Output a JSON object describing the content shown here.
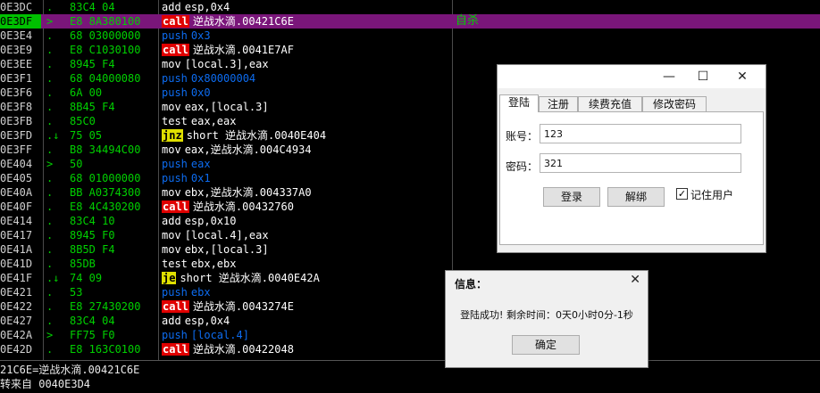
{
  "disasm": {
    "rows": [
      {
        "addr": "0E3DC",
        "mark": ".",
        "hex": "83C4 04",
        "mnem": "add",
        "ops": "esp,0x4",
        "kind": "plain",
        "sel": false
      },
      {
        "addr": "0E3DF",
        "mark": ">",
        "hex": "E8 8A380100",
        "mnem": "call",
        "ops": "逆战水滴.00421C6E",
        "kind": "call",
        "sel": true,
        "comment": "自杀"
      },
      {
        "addr": "0E3E4",
        "mark": ".",
        "hex": "68 03000000",
        "mnem": "push",
        "ops": "0x3",
        "kind": "push",
        "sel": false
      },
      {
        "addr": "0E3E9",
        "mark": ".",
        "hex": "E8 C1030100",
        "mnem": "call",
        "ops": "逆战水滴.0041E7AF",
        "kind": "call",
        "sel": false
      },
      {
        "addr": "0E3EE",
        "mark": ".",
        "hex": "8945 F4",
        "mnem": "mov",
        "ops": "[local.3],eax",
        "kind": "plain",
        "sel": false
      },
      {
        "addr": "0E3F1",
        "mark": ".",
        "hex": "68 04000080",
        "mnem": "push",
        "ops": "0x80000004",
        "kind": "push",
        "sel": false
      },
      {
        "addr": "0E3F6",
        "mark": ".",
        "hex": "6A 00",
        "mnem": "push",
        "ops": "0x0",
        "kind": "push",
        "sel": false
      },
      {
        "addr": "0E3F8",
        "mark": ".",
        "hex": "8B45 F4",
        "mnem": "mov",
        "ops": "eax,[local.3]",
        "kind": "plain",
        "sel": false
      },
      {
        "addr": "0E3FB",
        "mark": ".",
        "hex": "85C0",
        "mnem": "test",
        "ops": "eax,eax",
        "kind": "plain",
        "sel": false
      },
      {
        "addr": "0E3FD",
        "mark": ".↓",
        "hex": "75 05",
        "mnem": "jnz",
        "ops": "short 逆战水滴.0040E404",
        "kind": "jmp",
        "sel": false
      },
      {
        "addr": "0E3FF",
        "mark": ".",
        "hex": "B8 34494C00",
        "mnem": "mov",
        "ops": "eax,逆战水滴.004C4934",
        "kind": "plain",
        "sel": false
      },
      {
        "addr": "0E404",
        "mark": ">",
        "hex": "50",
        "mnem": "push",
        "ops": "eax",
        "kind": "push",
        "sel": false
      },
      {
        "addr": "0E405",
        "mark": ".",
        "hex": "68 01000000",
        "mnem": "push",
        "ops": "0x1",
        "kind": "push",
        "sel": false
      },
      {
        "addr": "0E40A",
        "mark": ".",
        "hex": "BB A0374300",
        "mnem": "mov",
        "ops": "ebx,逆战水滴.004337A0",
        "kind": "plain",
        "sel": false
      },
      {
        "addr": "0E40F",
        "mark": ".",
        "hex": "E8 4C430200",
        "mnem": "call",
        "ops": "逆战水滴.00432760",
        "kind": "call",
        "sel": false
      },
      {
        "addr": "0E414",
        "mark": ".",
        "hex": "83C4 10",
        "mnem": "add",
        "ops": "esp,0x10",
        "kind": "plain",
        "sel": false
      },
      {
        "addr": "0E417",
        "mark": ".",
        "hex": "8945 F0",
        "mnem": "mov",
        "ops": "[local.4],eax",
        "kind": "plain",
        "sel": false
      },
      {
        "addr": "0E41A",
        "mark": ".",
        "hex": "8B5D F4",
        "mnem": "mov",
        "ops": "ebx,[local.3]",
        "kind": "plain",
        "sel": false
      },
      {
        "addr": "0E41D",
        "mark": ".",
        "hex": "85DB",
        "mnem": "test",
        "ops": "ebx,ebx",
        "kind": "plain",
        "sel": false
      },
      {
        "addr": "0E41F",
        "mark": ".↓",
        "hex": "74 09",
        "mnem": "je",
        "ops": "short 逆战水滴.0040E42A",
        "kind": "jmp",
        "sel": false
      },
      {
        "addr": "0E421",
        "mark": ".",
        "hex": "53",
        "mnem": "push",
        "ops": "ebx",
        "kind": "push",
        "sel": false
      },
      {
        "addr": "0E422",
        "mark": ".",
        "hex": "E8 27430200",
        "mnem": "call",
        "ops": "逆战水滴.0043274E",
        "kind": "call",
        "sel": false
      },
      {
        "addr": "0E427",
        "mark": ".",
        "hex": "83C4 04",
        "mnem": "add",
        "ops": "esp,0x4",
        "kind": "plain",
        "sel": false
      },
      {
        "addr": "0E42A",
        "mark": ">",
        "hex": "FF75 F0",
        "mnem": "push",
        "ops": "[local.4]",
        "kind": "push",
        "sel": false
      },
      {
        "addr": "0E42D",
        "mark": ".",
        "hex": "E8 163C0100",
        "mnem": "call",
        "ops": "逆战水滴.00422048",
        "kind": "call",
        "sel": false
      }
    ]
  },
  "status": {
    "line1": "21C6E=逆战水滴.00421C6E",
    "line2": "转来自 0040E3D4"
  },
  "login": {
    "tabs": [
      "登陆",
      "注册",
      "续费充值",
      "修改密码"
    ],
    "account_label": "账号：",
    "account_value": "123",
    "password_label": "密码：",
    "password_value": "321",
    "login_button": "登录",
    "unbind_button": "解绑",
    "remember_label": "记住用户",
    "remember_checked": true,
    "minimize_glyph": "—",
    "maximize_glyph": "☐",
    "close_glyph": "✕"
  },
  "info": {
    "title": "信息：",
    "message": "登陆成功! 剩余时间：0天0小时0分-1秒",
    "ok_button": "确定",
    "close_glyph": "✕"
  },
  "colors": {
    "selected_row": "#7a167a",
    "call_bg": "#e00000",
    "jump_bg": "#e0e000",
    "push_color": "#0d6cf0",
    "hex_color": "#00d000"
  }
}
